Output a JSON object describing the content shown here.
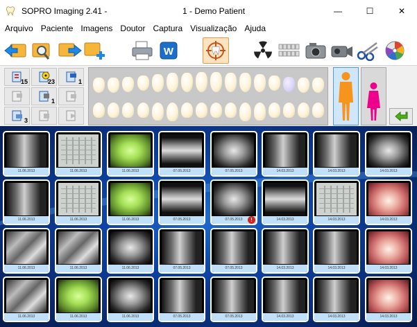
{
  "window": {
    "app_title": "SOPRO Imaging 2.41 -",
    "doc_title": "1 -  Demo Patient",
    "minimize": "—",
    "maximize": "☐",
    "close": "✕"
  },
  "menu": [
    "Arquivo",
    "Paciente",
    "Imagens",
    "Doutor",
    "Captura",
    "Visualização",
    "Ajuda"
  ],
  "toolbar": {
    "buttons": [
      {
        "icon": "back-folder-icon"
      },
      {
        "icon": "search-folder-icon"
      },
      {
        "icon": "forward-folder-icon"
      },
      {
        "icon": "new-folder-icon"
      },
      {
        "icon": "printer-icon"
      },
      {
        "icon": "word-export-icon"
      },
      {
        "icon": "capture-target-icon"
      },
      {
        "icon": "radiation-icon"
      },
      {
        "icon": "sensor-icon"
      },
      {
        "icon": "camera-icon"
      },
      {
        "icon": "video-camera-icon"
      },
      {
        "icon": "scissors-icon"
      },
      {
        "icon": "color-wheel-icon"
      }
    ]
  },
  "filters": {
    "buttons": [
      {
        "icon": "intraoral-camera-icon",
        "count": "15"
      },
      {
        "icon": "xray-sensor-icon",
        "count": "23"
      },
      {
        "icon": "panoramic-icon",
        "count": "1"
      },
      {
        "icon": "photo-filter-icon",
        "count": ""
      },
      {
        "icon": "radiography-icon",
        "count": "1"
      },
      {
        "icon": "document-filter-icon",
        "count": ""
      },
      {
        "icon": "scanner-icon",
        "count": "3"
      },
      {
        "icon": "ceph-icon",
        "count": ""
      },
      {
        "icon": "other-filter-icon",
        "count": ""
      }
    ],
    "person_male_color": "#f7941d",
    "person_female_color": "#ec008c",
    "back_arrow_color": "#4caf1a"
  },
  "thumbnails": [
    {
      "type": "xray",
      "caption": "11.06.2013"
    },
    {
      "type": "form",
      "caption": "11.06.2013"
    },
    {
      "type": "green",
      "caption": "11.06.2013"
    },
    {
      "type": "pano",
      "caption": "07.05.2013"
    },
    {
      "type": "xray2",
      "caption": "07.05.2013"
    },
    {
      "type": "xray",
      "caption": "14.03.2013"
    },
    {
      "type": "xray",
      "caption": "14.03.2013"
    },
    {
      "type": "xray2",
      "caption": "14.03.2013"
    },
    {
      "type": "xray",
      "caption": "11.06.2013"
    },
    {
      "type": "form",
      "caption": "11.06.2013"
    },
    {
      "type": "green",
      "caption": "11.06.2013"
    },
    {
      "type": "pano",
      "caption": "07.05.2013"
    },
    {
      "type": "xray2",
      "caption": "07.05.2013"
    },
    {
      "type": "pano",
      "caption": "14.03.2013"
    },
    {
      "type": "form",
      "caption": "14.03.2013"
    },
    {
      "type": "photo",
      "caption": "14.03.2013"
    },
    {
      "type": "sensor",
      "caption": "11.06.2013"
    },
    {
      "type": "sensor",
      "caption": "11.06.2013"
    },
    {
      "type": "xray2",
      "caption": "11.06.2013"
    },
    {
      "type": "xray",
      "caption": "07.05.2013"
    },
    {
      "type": "xray",
      "caption": "07.05.2013"
    },
    {
      "type": "xray",
      "caption": "14.03.2013"
    },
    {
      "type": "xray",
      "caption": "14.03.2013"
    },
    {
      "type": "photo",
      "caption": "14.03.2013"
    },
    {
      "type": "sensor",
      "caption": "11.06.2013"
    },
    {
      "type": "green",
      "caption": "11.06.2013"
    },
    {
      "type": "xray2",
      "caption": "11.06.2013"
    },
    {
      "type": "xray",
      "caption": "07.05.2013"
    },
    {
      "type": "xray",
      "caption": "07.05.2013"
    },
    {
      "type": "xray",
      "caption": "14.03.2013"
    },
    {
      "type": "xray",
      "caption": "14.03.2013"
    },
    {
      "type": "photo",
      "caption": "14.03.2013"
    }
  ],
  "alert_badge": "!"
}
